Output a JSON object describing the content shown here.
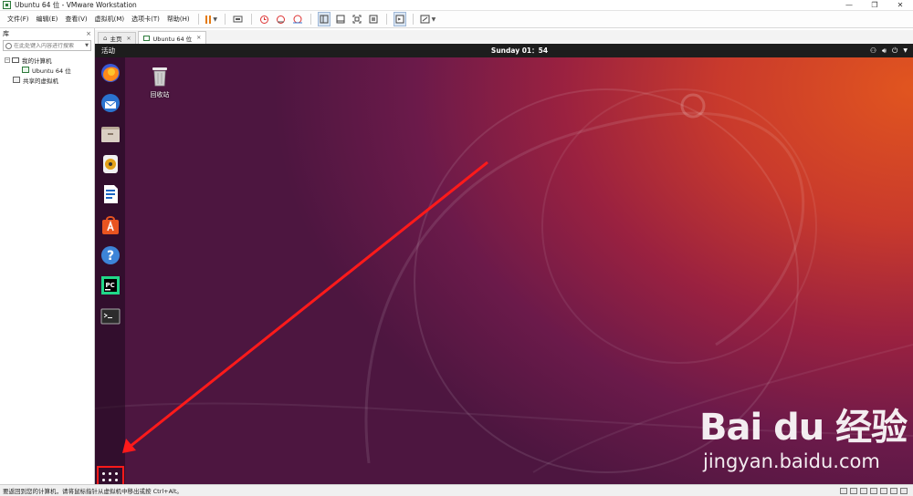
{
  "window": {
    "title": "Ubuntu 64 位 - VMware Workstation",
    "controls": {
      "minimize": "—",
      "restore": "❐",
      "close": "✕"
    }
  },
  "menubar": {
    "items": [
      "文件(F)",
      "编辑(E)",
      "查看(V)",
      "虚拟机(M)",
      "选项卡(T)",
      "帮助(H)"
    ]
  },
  "library": {
    "title": "库",
    "close": "×",
    "search_placeholder": "在此处键入内容进行搜索",
    "tree": {
      "root": "我的计算机",
      "child": "Ubuntu 64 位",
      "shared": "共享的虚拟机"
    }
  },
  "tabs": [
    {
      "label": "主页"
    },
    {
      "label": "Ubuntu 64 位"
    }
  ],
  "ubuntu": {
    "activities": "活动",
    "clock": "Sunday 01：54",
    "trash_label": "回收站",
    "dock_icons": [
      "firefox-icon",
      "thunderbird-icon",
      "files-icon",
      "rhythmbox-icon",
      "libreoffice-writer-icon",
      "software-center-icon",
      "help-icon",
      "pycharm-icon",
      "terminal-icon"
    ]
  },
  "watermark": {
    "logo": "Bai du 经验",
    "url": "jingyan.baidu.com"
  },
  "statusbar": {
    "message": "要返回到您的计算机，请将鼠标指针从虚拟机中移出或按 Ctrl+Alt。"
  },
  "colors": {
    "annotation_red": "#ff1a1a",
    "gnome_bar": "#1d1d1d",
    "vmware_pause": "#e47a12"
  }
}
